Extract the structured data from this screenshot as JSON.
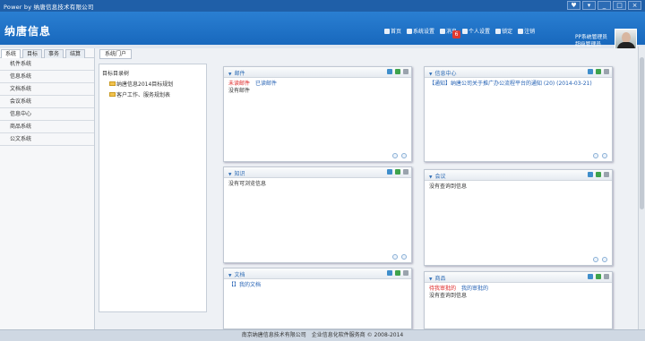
{
  "window": {
    "title": "Power by 纳唐信息技术有限公司",
    "buttons": [
      "♥",
      "▾",
      "_",
      "□",
      "×"
    ]
  },
  "header": {
    "logo": "纳唐信息"
  },
  "topnav": [
    {
      "label": "首页",
      "icon": "home-icon"
    },
    {
      "label": "系统设置",
      "icon": "settings-icon"
    },
    {
      "label": "消息",
      "icon": "message-icon"
    },
    {
      "label": "个人设置",
      "icon": "gear-icon"
    },
    {
      "label": "锁定",
      "icon": "lock-icon"
    },
    {
      "label": "注销",
      "icon": "power-icon"
    }
  ],
  "badge": "6",
  "user": {
    "line1": "PP系统管理员",
    "line2": "超级管理员"
  },
  "left_tabs": [
    "系统",
    "目标",
    "事务",
    "结算"
  ],
  "left_menu": [
    "机件系统",
    "信息系统",
    "文档系统",
    "会议系统",
    "信息中心",
    "商品系统",
    "公文系统"
  ],
  "content_tab": "系统门户",
  "tree": {
    "root": "目标目录树",
    "nodes": [
      "纳唐信息2014目标规划",
      "客户工作、服务规划表"
    ]
  },
  "portlets": {
    "mail": {
      "title": "邮件",
      "link1": "未读邮件",
      "link2": "已读邮件",
      "text": "没有邮件"
    },
    "news": {
      "title": "信息中心",
      "item": "【通知】纳唐公司关于推广办公流程平台的通知 (20) (2014-03-21)"
    },
    "notice": {
      "title": "知识",
      "text": "没有可浏览信息"
    },
    "meeting": {
      "title": "会议",
      "text": "没有查询到信息"
    },
    "docs": {
      "title": "文档",
      "text": "【】我的文档"
    },
    "goods": {
      "title": "商品",
      "link1": "待我审批的",
      "link2": "我的审批的",
      "text": "没有查询到信息"
    }
  },
  "footer": "南京纳唐信息技术有限公司　企业信息化软件服务商 © 2008-2014"
}
